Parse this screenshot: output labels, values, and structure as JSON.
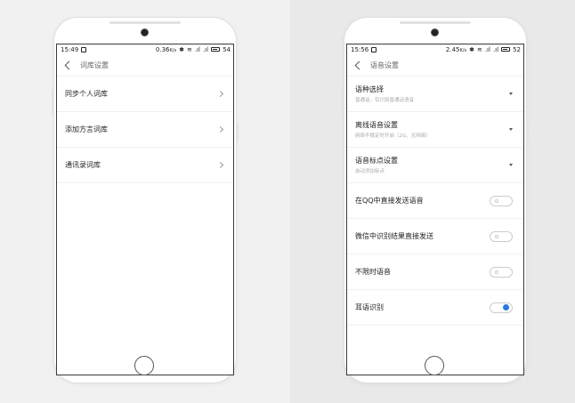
{
  "left": {
    "status": {
      "time": "15:49",
      "speed": "0.36",
      "battery": "54"
    },
    "title": "词库设置",
    "items": [
      {
        "label": "同步个人词库"
      },
      {
        "label": "添加方言词库"
      },
      {
        "label": "通讯录词库"
      }
    ]
  },
  "right": {
    "status": {
      "time": "15:56",
      "speed": "2.45",
      "battery": "52"
    },
    "title": "语音设置",
    "dropdowns": [
      {
        "label": "语种选择",
        "sub": "普通话，仅识别普通话语音"
      },
      {
        "label": "离线语音设置",
        "sub": "网络不稳定时开启（2G、无网络）"
      },
      {
        "label": "语音标点设置",
        "sub": "自动添加标点"
      }
    ],
    "toggles": [
      {
        "label": "在QQ中直接发送语音",
        "on": false
      },
      {
        "label": "微信中识别结果直接发送",
        "on": false
      },
      {
        "label": "不限时语音",
        "on": false
      },
      {
        "label": "耳语识别",
        "on": true
      }
    ]
  },
  "colors": {
    "accent": "#2a7ae4"
  }
}
